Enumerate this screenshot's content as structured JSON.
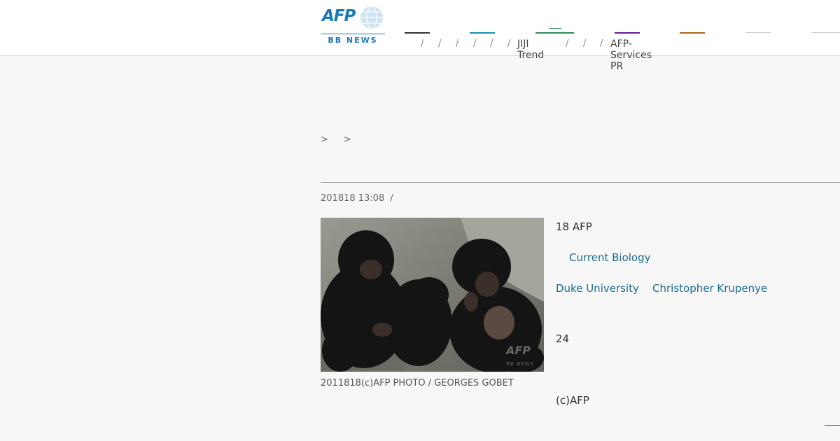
{
  "logo": {
    "mark": "AFP",
    "subtitle": "BB NEWS"
  },
  "nav": {
    "separator": "/",
    "item_jiji": "JIJI Trend",
    "item_pr": "AFP-Services PR",
    "colors": [
      "#333333",
      "#1a8fb0",
      "#2e8b57",
      "#6a1b9a",
      "#b5651d",
      "#cccccc",
      "#cccccc"
    ]
  },
  "breadcrumb": {
    "sep1": ">",
    "sep2": ">"
  },
  "article": {
    "title": "",
    "meta_date": "201818 13:08",
    "meta_slash": "/",
    "photo_caption": "2011818(c)AFP PHOTO / GEORGES GOBET",
    "watermark": "AFP BB NEWS",
    "p1": "18 AFP",
    "link_journal": "Current Biology",
    "link_university": "Duke University",
    "link_person": "Christopher Krupenye",
    "p4": "24",
    "credit": "(c)AFP",
    "corner_glyph": ""
  }
}
